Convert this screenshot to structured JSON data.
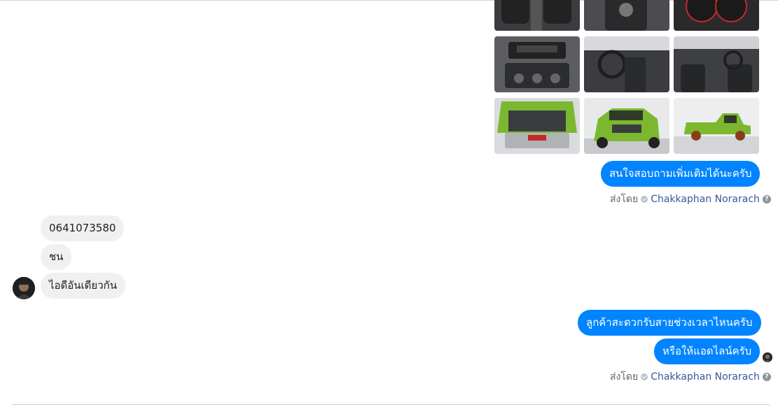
{
  "photos": [
    {
      "name": "photo-interior-seats",
      "kind": "seats"
    },
    {
      "name": "photo-interior-console",
      "kind": "console"
    },
    {
      "name": "photo-dashboard-gauges",
      "kind": "gauges"
    },
    {
      "name": "photo-center-stack",
      "kind": "stack"
    },
    {
      "name": "photo-interior-driver",
      "kind": "driver"
    },
    {
      "name": "photo-interior-cabin",
      "kind": "cabin"
    },
    {
      "name": "photo-engine-bay",
      "kind": "engine"
    },
    {
      "name": "photo-truck-front",
      "kind": "front"
    },
    {
      "name": "photo-truck-side",
      "kind": "side"
    }
  ],
  "messages": {
    "out1": "สนใจสอบถามเพิ่มเติมได้นะครับ",
    "in1": "0641073580",
    "in2": "ชน",
    "in3": "ไอดีอันเดียวกัน",
    "out2": "ลูกค้าสะดวกรับสายช่วงเวลาไหนครับ",
    "out3": "หรือให้แอดไลน์ครับ"
  },
  "sent_by": {
    "label": "ส่งโดย",
    "name": "Chakkaphan Norarach",
    "help": "?"
  },
  "colors": {
    "outgoing": "#0084ff",
    "incoming": "#f0f0f0",
    "truck_green": "#7cb82f"
  }
}
